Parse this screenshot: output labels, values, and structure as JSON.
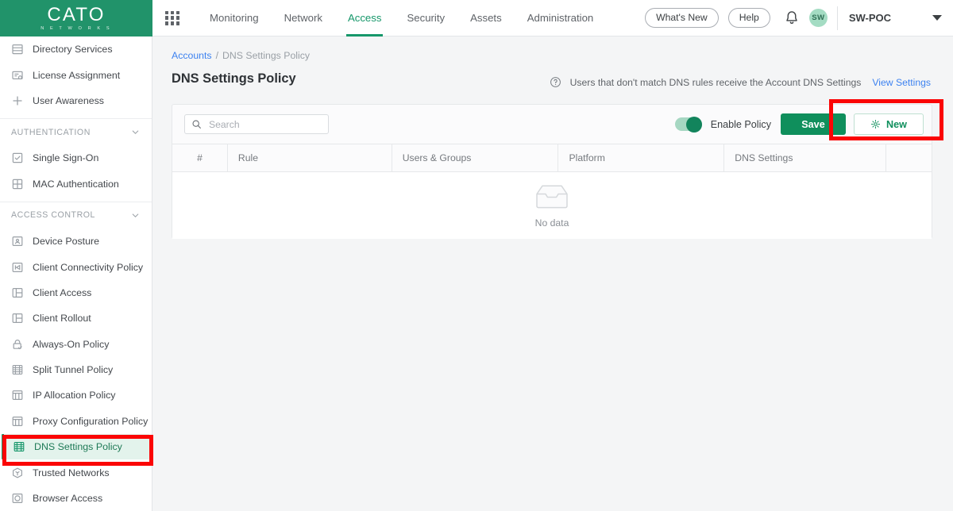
{
  "brand": {
    "name": "CATO",
    "tagline": "N E T W O R K S",
    "color": "#21936a"
  },
  "topnav": {
    "apps_icon": "grid-apps-icon",
    "items": [
      {
        "label": "Monitoring",
        "active": false
      },
      {
        "label": "Network",
        "active": false
      },
      {
        "label": "Access",
        "active": true
      },
      {
        "label": "Security",
        "active": false
      },
      {
        "label": "Assets",
        "active": false
      },
      {
        "label": "Administration",
        "active": false
      }
    ],
    "whats_new": "What's New",
    "help": "Help",
    "notifications_icon": "bell-icon",
    "avatar_initials": "SW",
    "account": "SW-POC",
    "account_caret_icon": "caret-down-icon"
  },
  "sidebar": {
    "items": [
      {
        "label": "Directory Services",
        "icon": "directory-icon",
        "type": "item"
      },
      {
        "label": "License Assignment",
        "icon": "license-icon",
        "type": "item"
      },
      {
        "label": "User Awareness",
        "icon": "plus-icon",
        "type": "item"
      },
      {
        "label": "AUTHENTICATION",
        "icon": "chevron-down-icon",
        "type": "section"
      },
      {
        "label": "Single Sign-On",
        "icon": "checkbox-icon",
        "type": "item"
      },
      {
        "label": "MAC Authentication",
        "icon": "grid4-icon",
        "type": "item"
      },
      {
        "label": "ACCESS CONTROL",
        "icon": "chevron-down-icon",
        "type": "section"
      },
      {
        "label": "Device Posture",
        "icon": "monitor-icon",
        "type": "item"
      },
      {
        "label": "Client Connectivity Policy",
        "icon": "connectivity-icon",
        "type": "item"
      },
      {
        "label": "Client Access",
        "icon": "panels-icon",
        "type": "item"
      },
      {
        "label": "Client Rollout",
        "icon": "panels-icon",
        "type": "item"
      },
      {
        "label": "Always-On Policy",
        "icon": "lock-check-icon",
        "type": "item"
      },
      {
        "label": "Split Tunnel Policy",
        "icon": "split-tunnel-icon",
        "type": "item"
      },
      {
        "label": "IP Allocation Policy",
        "icon": "columns-icon",
        "type": "item"
      },
      {
        "label": "Proxy Configuration Policy",
        "icon": "columns-icon",
        "type": "item"
      },
      {
        "label": "DNS Settings Policy",
        "icon": "dns-icon",
        "type": "item",
        "selected": true
      },
      {
        "label": "Trusted Networks",
        "icon": "shield-box-icon",
        "type": "item"
      },
      {
        "label": "Browser Access",
        "icon": "browser-icon",
        "type": "item"
      }
    ]
  },
  "breadcrumb": {
    "root": "Accounts",
    "separator": "/",
    "current": "DNS Settings Policy"
  },
  "page": {
    "title": "DNS Settings Policy",
    "note_icon": "question-circle-icon",
    "note_text": "Users that don't match DNS rules receive the Account DNS Settings",
    "note_link": "View Settings"
  },
  "toolbar": {
    "search_icon": "search-icon",
    "search_value": "",
    "search_placeholder": "Search",
    "toggle_label": "Enable Policy",
    "toggle_state": "on",
    "save_label": "Save",
    "new_label": "New",
    "new_icon": "sparkle-icon"
  },
  "table": {
    "columns": [
      "#",
      "Rule",
      "Users & Groups",
      "Platform",
      "DNS Settings",
      ""
    ],
    "rows": [],
    "empty_icon": "inbox-empty-icon",
    "empty_text": "No data"
  },
  "annotations": [
    {
      "name": "enable-policy-toggle-highlight",
      "color": "#fb0505"
    },
    {
      "name": "dns-settings-policy-sidebar-highlight",
      "color": "#fb0505"
    }
  ]
}
